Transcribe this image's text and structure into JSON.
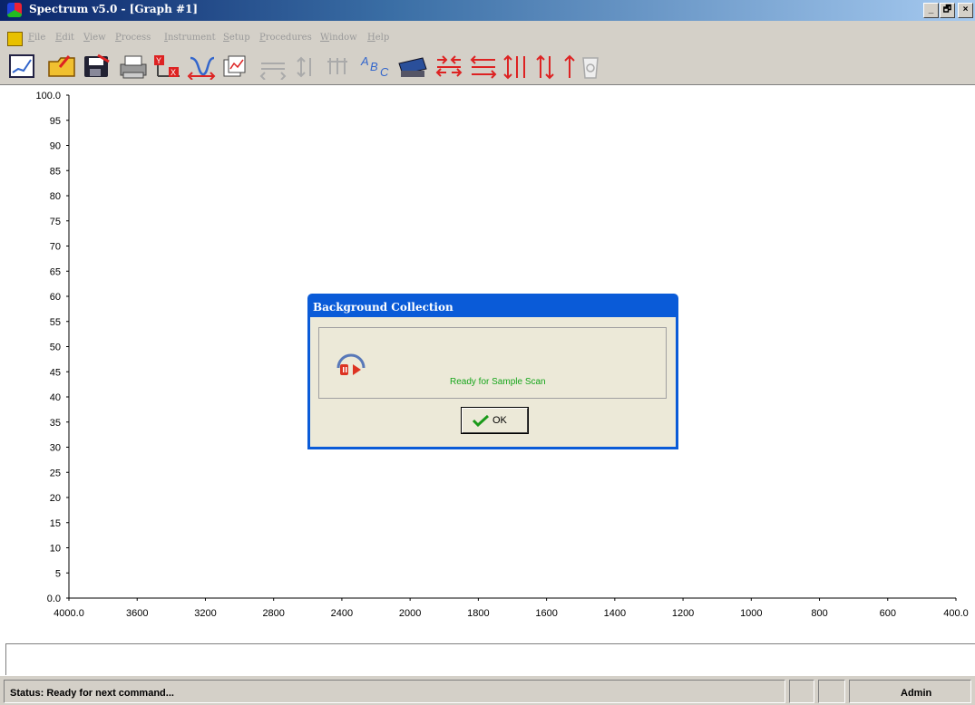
{
  "window": {
    "title": "Spectrum v5.0 - [Graph #1]",
    "controls": {
      "minimize": "_",
      "restore": "🗗",
      "close": "×"
    },
    "child_controls": {
      "minimize": "_",
      "restore": "🗗",
      "close": "×"
    }
  },
  "menu": {
    "items": [
      "File",
      "Edit",
      "View",
      "Process",
      "Instrument",
      "Setup",
      "Procedures",
      "Window",
      "Help"
    ]
  },
  "toolbar": {
    "icons": [
      "new-graph-icon",
      "open-folder-icon",
      "save-icon",
      "print-icon",
      "xy-scale-icon",
      "peak-pick-icon",
      "overlay-icon",
      "horizontal-expand-icon",
      "vertical-expand-icon",
      "cursor-icon",
      "text-label-icon",
      "scan-instrument-icon",
      "compress-horizontal-icon",
      "expand-horizontal-icon",
      "vertical-arrows-icon",
      "up-down-arrows-icon",
      "up-arrow-icon",
      "trash-icon"
    ]
  },
  "chart_data": {
    "type": "line",
    "series": [],
    "xlim": [
      4000,
      400
    ],
    "ylim": [
      0,
      100
    ],
    "x_ticks": [
      "4000.0",
      "3600",
      "3200",
      "2800",
      "2400",
      "2000",
      "1800",
      "1600",
      "1400",
      "1200",
      "1000",
      "800",
      "600",
      "400.0"
    ],
    "y_ticks": [
      "100.0",
      "95",
      "90",
      "85",
      "80",
      "75",
      "70",
      "65",
      "60",
      "55",
      "50",
      "45",
      "40",
      "35",
      "30",
      "25",
      "20",
      "15",
      "10",
      "5",
      "0.0"
    ],
    "grid": false
  },
  "dialog": {
    "title": "Background Collection",
    "message": "Ready for Sample Scan",
    "ok_label": "OK",
    "message_color": "#15a51a"
  },
  "status": {
    "text": "Status: Ready for next command...",
    "user": "Admin"
  }
}
